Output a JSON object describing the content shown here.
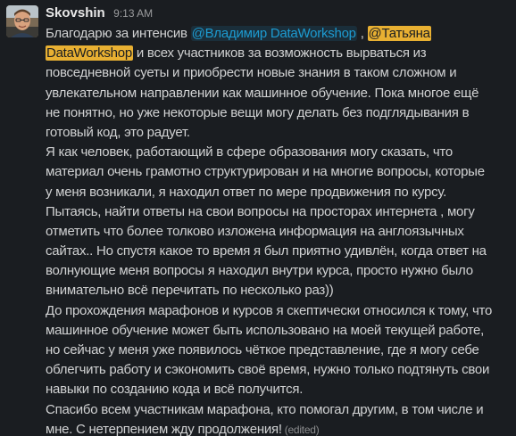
{
  "message": {
    "sender": "Skovshin",
    "time": "9:13 AM",
    "edited_label": "(edited)"
  },
  "body": {
    "l1": {
      "before": "Благодарю за интенсив ",
      "mention_1": "@Владимир DataWorkshop",
      "comma": " , ",
      "mention_2_part_a": "@Татьяна"
    },
    "l2": {
      "mention_2_part_b": "DataWorkshop",
      "after": " и всех участников за возможность вырваться из"
    },
    "lines_rest": [
      "повседневной суеты и приобрести новые знания в таком сложном и",
      "увлекательном направлении как машинное обучение. Пока многое ещё",
      "не понятно, но уже некоторые вещи могу делать без подглядывания в",
      "готовый код, это радует.",
      "Я как человек, работающий в сфере образования могу сказать, что",
      "материал очень грамотно структурирован и на многие вопросы, которые",
      "у меня возникали, я находил ответ по мере продвижения по курсу.",
      "Пытаясь, найти ответы на свои вопросы на просторах интернета , могу",
      "отметить что  более толково изложена информация на англоязычных",
      "сайтах.. Но спустя какое то время я был приятно удивлён, когда ответ на",
      "волнующие меня вопросы я находил внутри курса, просто нужно было",
      "внимательно всё перечитать по несколько раз))",
      "До прохождения марафонов и курсов я скептически относился к тому, что",
      "машинное обучение может быть использовано на моей текущей работе,",
      "но сейчас у меня уже появилось чёткое представление, где я могу себе",
      "облегчить работу и сэкономить своё время, нужно только подтянуть свои",
      "навыки по созданию кода и всё получится.",
      "Спасибо всем участникам марафона, кто помогал другим, в том числе и"
    ],
    "last_line": "мне. С нетерпением жду продолжения!"
  }
}
